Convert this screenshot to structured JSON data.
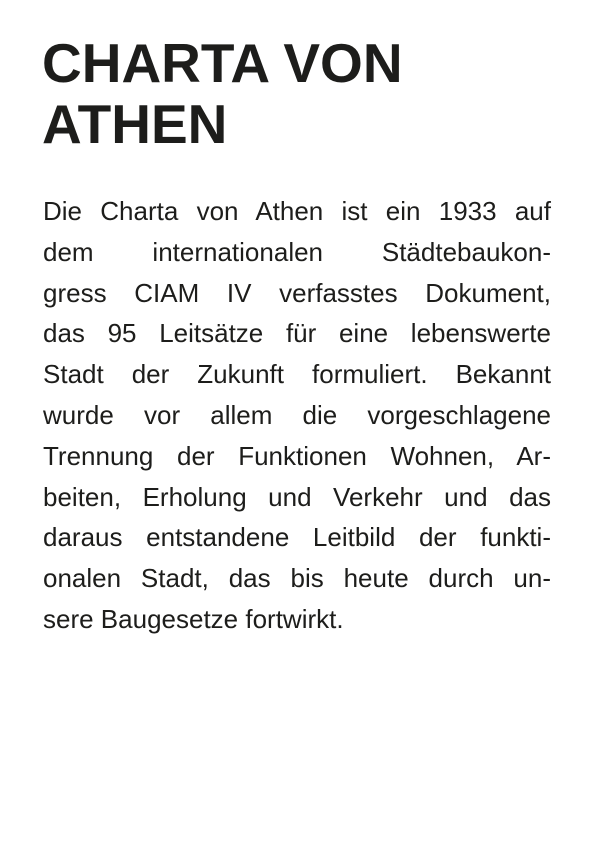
{
  "title_lines": [
    "CHARTA VON",
    "ATHEN"
  ],
  "paragraph_lines": [
    "Die Charta von Athen ist ein 1933 auf",
    "dem internationalen Städtebaukon-",
    "gress CIAM IV verfasstes Dokument,",
    "das 95 Leitsätze für eine lebenswerte",
    "Stadt der Zukunft formuliert. Bekannt",
    "wurde vor allem die vorgeschlagene",
    "Trennung der Funktionen Wohnen, Ar-",
    "beiten, Erholung und Verkehr und das",
    "daraus entstandene Leitbild der funkti-",
    "onalen Stadt, das bis heute durch un-",
    "sere Baugesetze fortwirkt."
  ]
}
